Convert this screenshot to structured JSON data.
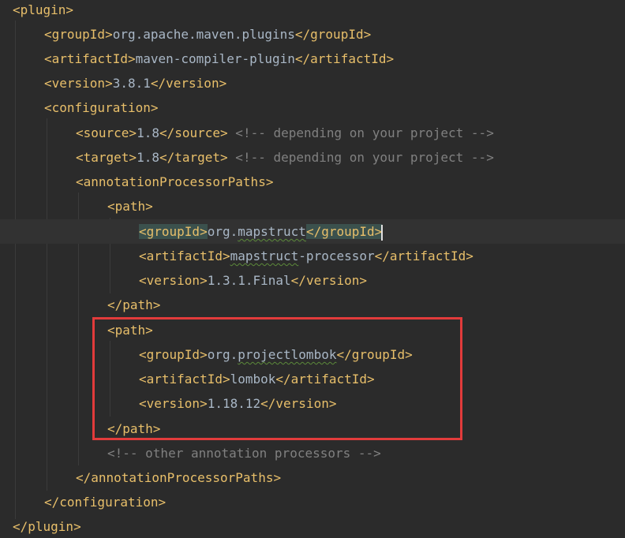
{
  "colors": {
    "background": "#2b2b2b",
    "tag": "#e8bf6a",
    "text": "#a9b7c6",
    "comment": "#808080",
    "match_highlight": "#3b514d",
    "annotation_box": "#e23b3b"
  },
  "lines": [
    {
      "tag_open": "<plugin>"
    },
    {
      "tag_open": "<groupId>",
      "text": "org.apache.maven.plugins",
      "tag_close": "</groupId>"
    },
    {
      "tag_open": "<artifactId>",
      "text": "maven-compiler-plugin",
      "tag_close": "</artifactId>"
    },
    {
      "tag_open": "<version>",
      "text": "3.8.1",
      "tag_close": "</version>"
    },
    {
      "tag_open": "<configuration>"
    },
    {
      "tag_open": "<source>",
      "text": "1.8",
      "tag_close": "</source>",
      "comment": " <!-- depending on your project -->"
    },
    {
      "tag_open": "<target>",
      "text": "1.8",
      "tag_close": "</target>",
      "comment": " <!-- depending on your project -->"
    },
    {
      "tag_open": "<annotationProcessorPaths>"
    },
    {
      "tag_open": "<path>"
    },
    {
      "tag_open": "<groupId>",
      "text_prefix": "org.",
      "text_squiggle": "mapstruct",
      "tag_close": "</groupId>"
    },
    {
      "tag_open": "<artifactId>",
      "text_squiggle": "mapstruct",
      "text_suffix": "-processor",
      "tag_close": "</artifactId>"
    },
    {
      "tag_open": "<version>",
      "text": "1.3.1.Final",
      "tag_close": "</version>"
    },
    {
      "tag_close": "</path>"
    },
    {
      "tag_open": "<path>"
    },
    {
      "tag_open": "<groupId>",
      "text_prefix": "org.",
      "text_squiggle": "projectlombok",
      "tag_close": "</groupId>"
    },
    {
      "tag_open": "<artifactId>",
      "text": "lombok",
      "tag_close": "</artifactId>"
    },
    {
      "tag_open": "<version>",
      "text": "1.18.12",
      "tag_close": "</version>"
    },
    {
      "tag_close": "</path>"
    },
    {
      "comment": "<!-- other annotation processors -->"
    },
    {
      "tag_close": "</annotationProcessorPaths>"
    },
    {
      "tag_close": "</configuration>"
    },
    {
      "tag_close": "</plugin>"
    }
  ]
}
